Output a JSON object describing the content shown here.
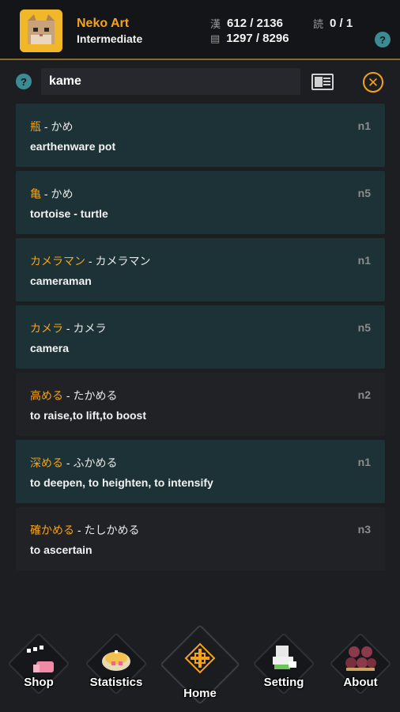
{
  "header": {
    "username": "Neko Art",
    "level": "Intermediate",
    "kanji_label": "漢",
    "kanji_progress": "612 / 2136",
    "reading_label": "読",
    "reading_progress": "0 / 1",
    "vocab_label": "▤",
    "vocab_progress": "1297 / 8296",
    "help": "?"
  },
  "search": {
    "help": "?",
    "query": "kame",
    "close": "✕"
  },
  "results": [
    {
      "kanji": "瓶",
      "reading": "かめ",
      "meaning": "earthenware pot",
      "jlpt": "n1",
      "style": "teal"
    },
    {
      "kanji": "亀",
      "reading": "かめ",
      "meaning": "tortoise - turtle",
      "jlpt": "n5",
      "style": "teal"
    },
    {
      "kanji": "カメラマン",
      "reading": "カメラマン",
      "meaning": "cameraman",
      "jlpt": "n1",
      "style": "teal"
    },
    {
      "kanji": "カメラ",
      "reading": "カメラ",
      "meaning": "camera",
      "jlpt": "n5",
      "style": "teal"
    },
    {
      "kanji": "高める",
      "reading": "たかめる",
      "meaning": "to raise,to lift,to boost",
      "jlpt": "n2",
      "style": "dark"
    },
    {
      "kanji": "深める",
      "reading": "ふかめる",
      "meaning": "to deepen, to heighten, to intensify",
      "jlpt": "n1",
      "style": "teal"
    },
    {
      "kanji": "確かめる",
      "reading": "たしかめる",
      "meaning": "to ascertain",
      "jlpt": "n3",
      "style": "dark"
    }
  ],
  "nav": {
    "shop": "Shop",
    "statistics": "Statistics",
    "home": "Home",
    "setting": "Setting",
    "about": "About"
  },
  "colors": {
    "accent": "#f5a31a",
    "card_teal": "#1c3236",
    "card_dark": "#202226",
    "help": "#3c8a92"
  }
}
